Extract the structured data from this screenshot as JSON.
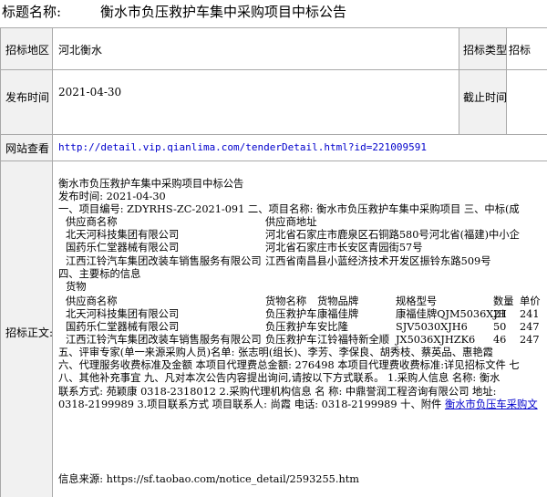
{
  "header": {
    "label": "标题名称:",
    "title": "衡水市负压救护车集中采购项目中标公告"
  },
  "fields": {
    "region_label": "招标地区",
    "region_value": "河北衡水",
    "type_label": "招标类型",
    "type_label2": "招标",
    "date_label": "发布时间",
    "date_value": "2021-04-30",
    "deadline_label": "截止时间",
    "web_label": "网站查看",
    "web_url": "http://detail.vip.qianlima.com/tenderDetail.html?id=221009591",
    "body_label": "招标正文:"
  },
  "body": {
    "heading": "衡水市负压救护车集中采购项目中标公告",
    "pub": "发布时间: 2021-04-30",
    "line1": "一、项目编号: ZDYRHS-ZC-2021-091 二、项目名称: 衡水市负压救护车集中采购项目 三、中标(成",
    "supplier_header": "供应商名称",
    "address_header": "供应商地址",
    "suppliers": [
      {
        "name": "北天河科技集团有限公司",
        "address": "河北省石家庄市鹿泉区石铜路580号河北省(福建)中小企"
      },
      {
        "name": "国药乐仁堂器械有限公司",
        "address": "河北省石家庄市长安区青园街57号"
      },
      {
        "name": "江西江铃汽车集团改装车销售服务有限公司",
        "address": "江西省南昌县小蓝经济技术开发区振铃东路509号"
      }
    ],
    "section4": "四、主要标的信息",
    "goods": "货物",
    "goods_headers": {
      "supplier": "供应商名称",
      "name": "货物名称",
      "brand": "货物品牌",
      "model": "规格型号",
      "qty": "数量",
      "price": "单价"
    },
    "goods_rows": [
      {
        "supplier": "北天河科技集团有限公司",
        "name": "负压救护车",
        "brand": "康福佳牌",
        "model": "康福佳牌QJM5036XJH",
        "qty": "21",
        "price": "241"
      },
      {
        "supplier": "国药乐仁堂器械有限公司",
        "name": "负压救护车",
        "brand": "安比隆",
        "model": "SJV5030XJH6",
        "qty": "50",
        "price": "247"
      },
      {
        "supplier": "江西江铃汽车集团改装车销售服务有限公司",
        "name": "负压救护车",
        "brand": "江铃福特新全顺",
        "model": "JX5036XJHZK6",
        "qty": "46",
        "price": "247"
      }
    ],
    "line5": "五、评审专家(单一来源采购人员)名单: 张志明(组长)、李芳、李保良、胡秀枝、蔡英品、惠艳霞",
    "line6": "六、代理服务收费标准及金额 本项目代理费总金额: 276498 本项目代理费收费标准:详见招标文件 七",
    "line7": "八、其他补充事宜 九、凡对本次公告内容提出询问,请按以下方式联系。 1.采购人信息 名称: 衡水",
    "line8": "联系方式: 苑颖康 0318-2318012 2.采购代理机构信息 名 称: 中鼎誉润工程咨询有限公司 地址:",
    "line9a": "0318-2199989 3.项目联系方式 项目联系人: 尚霞 电话: 0318-2199989 十、附件 ",
    "line9b": "衡水市负压车采购文",
    "source": "信息来源: https://sf.taobao.com/notice_detail/2593255.htm"
  }
}
